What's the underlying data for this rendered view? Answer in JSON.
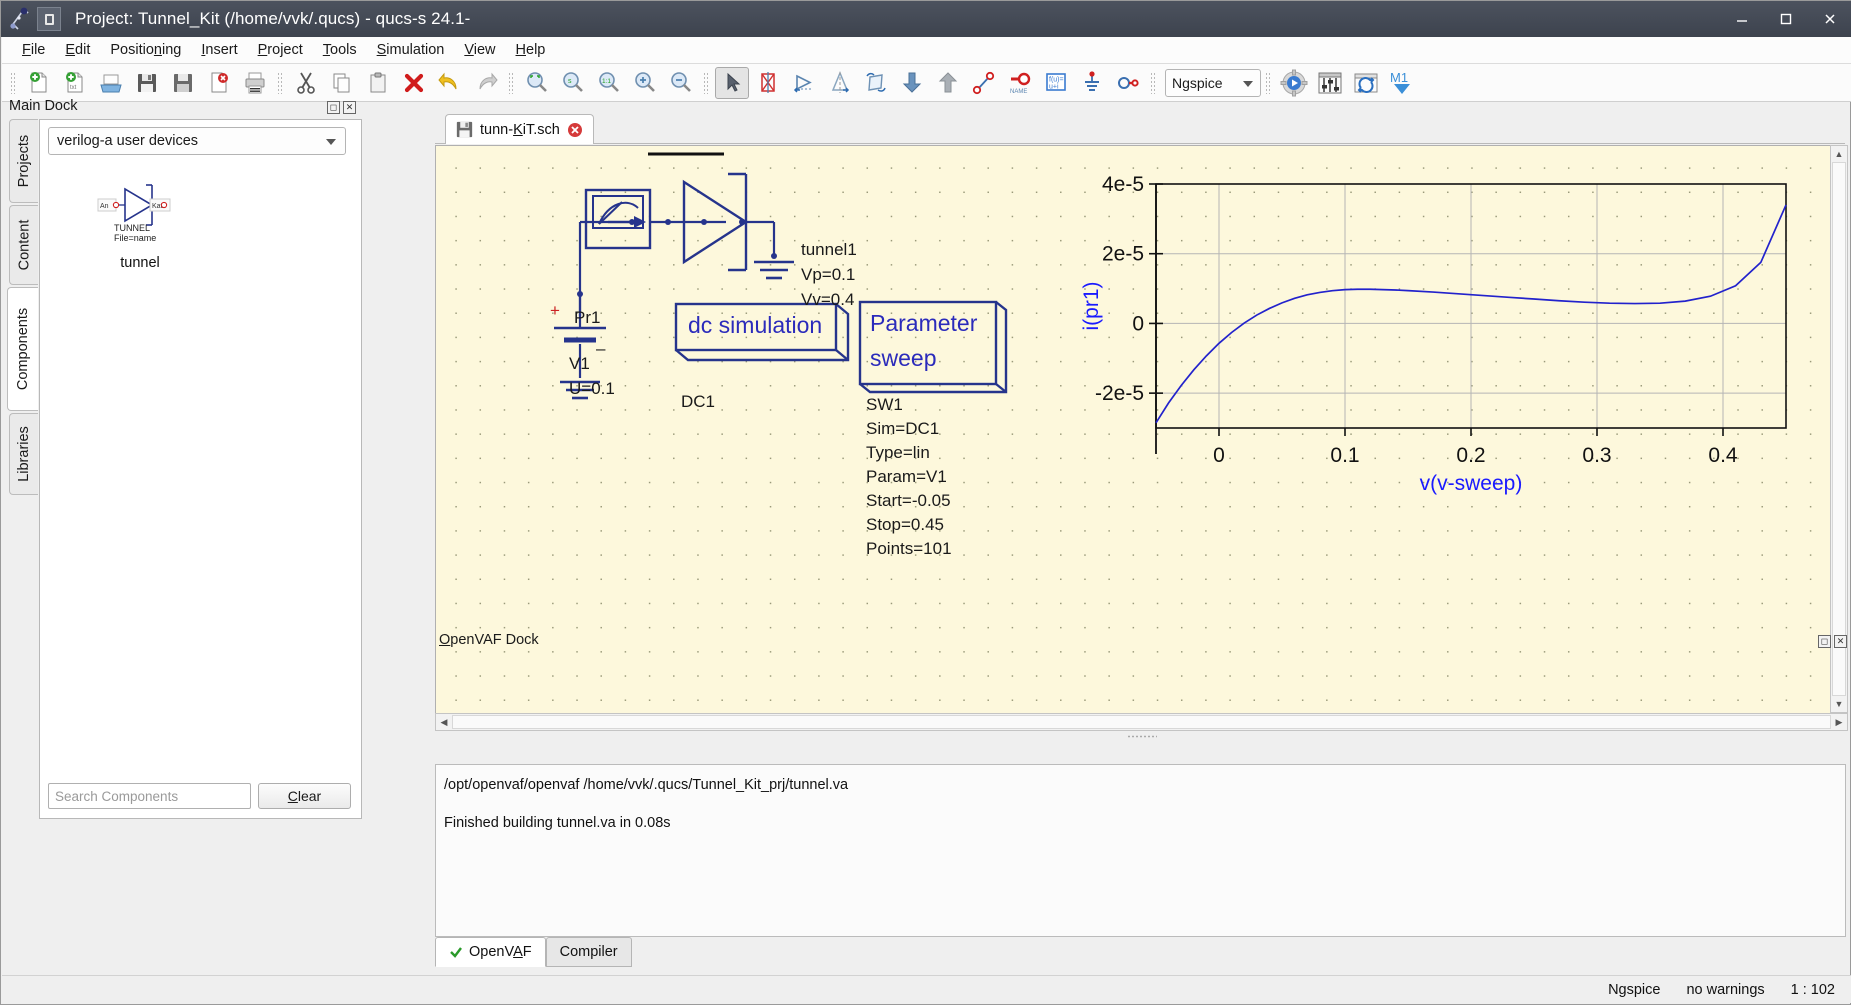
{
  "window": {
    "title": "Project: Tunnel_Kit (/home/vvk/.qucs) - qucs-s 24.1-",
    "minimize": "minimize-button",
    "maximize": "maximize-button",
    "close": "close-button"
  },
  "menu": {
    "items": [
      {
        "label": "File",
        "accel": "F"
      },
      {
        "label": "Edit",
        "accel": "E"
      },
      {
        "label": "Positioning",
        "accel": "n"
      },
      {
        "label": "Insert",
        "accel": "I"
      },
      {
        "label": "Project",
        "accel": "P"
      },
      {
        "label": "Tools",
        "accel": "T"
      },
      {
        "label": "Simulation",
        "accel": "S"
      },
      {
        "label": "View",
        "accel": "V"
      },
      {
        "label": "Help",
        "accel": "H"
      }
    ]
  },
  "toolbar": {
    "simulator_value": "Ngspice",
    "icons": [
      "new-document-icon",
      "new-text-document-icon",
      "open-folder-icon",
      "save-icon",
      "save-as-icon",
      "close-document-icon",
      "print-icon",
      "cut-icon",
      "copy-icon",
      "paste-icon",
      "delete-icon",
      "undo-icon",
      "redo-icon",
      "zoom-area-icon",
      "zoom-fit-icon",
      "zoom-one-to-one-icon",
      "zoom-in-icon",
      "zoom-out-icon",
      "select-arrow-icon",
      "delete-wire-icon",
      "rotate-icon",
      "mirror-x-icon",
      "mirror-y-icon",
      "move-down-icon",
      "move-up-icon",
      "wire-icon",
      "wire-label-icon",
      "equation-icon",
      "ground-icon",
      "port-icon",
      "simulate-icon",
      "settings-sliders-icon",
      "refresh-icon",
      "marker-m1-icon"
    ]
  },
  "main_dock": {
    "title": "Main Dock",
    "tabs": [
      {
        "label": "Projects",
        "selected": false
      },
      {
        "label": "Content",
        "selected": false
      },
      {
        "label": "Components",
        "selected": true
      },
      {
        "label": "Libraries",
        "selected": false
      }
    ],
    "category": "verilog-a user devices",
    "component": {
      "symbol_label_1": "TUNNEL",
      "symbol_label_2": "File=name",
      "pin_left": "An",
      "pin_right": "Kat",
      "caption": "tunnel"
    },
    "search_placeholder": "Search Components",
    "clear_label": "Clear",
    "clear_accel": "C"
  },
  "document": {
    "tab_label": "tunn-KiT.sch",
    "tab_accel": "K",
    "tab_icon": "save-icon",
    "close_icon": "close-tab-icon"
  },
  "schematic": {
    "probe_label": "Pr1",
    "source_name": "V1",
    "source_value": "U=0.1",
    "source_plus": "+",
    "source_minus": "–",
    "device": {
      "name": "tunnel1",
      "params": [
        "Vp=0.1",
        "Vv=0.4"
      ]
    },
    "dc_block": {
      "title": "dc simulation",
      "name": "DC1"
    },
    "sweep_block": {
      "title_line1": "Parameter",
      "title_line2": "sweep",
      "props": [
        "SW1",
        "Sim=DC1",
        "Type=lin",
        "Param=V1",
        "Start=-0.05",
        "Stop=0.45",
        "Points=101"
      ]
    }
  },
  "chart_data": {
    "type": "line",
    "title": "",
    "xlabel": "v(v-sweep)",
    "ylabel": "i(pr1)",
    "xticks": [
      "0",
      "0.1",
      "0.2",
      "0.3",
      "0.4"
    ],
    "xtick_values": [
      0,
      0.1,
      0.2,
      0.3,
      0.4
    ],
    "yticks": [
      "4e-5",
      "2e-5",
      "0",
      "-2e-5"
    ],
    "ytick_values": [
      4e-05,
      2e-05,
      0,
      -2e-05
    ],
    "xlim": [
      -0.05,
      0.45
    ],
    "ylim": [
      -3e-05,
      4e-05
    ],
    "grid": true,
    "legend": false,
    "axis_label_color": "#1a1aff",
    "line_color": "#2222cc",
    "series": [
      {
        "name": "i(pr1)",
        "x": [
          -0.05,
          -0.04,
          -0.03,
          -0.02,
          -0.01,
          0.0,
          0.01,
          0.02,
          0.03,
          0.04,
          0.05,
          0.06,
          0.07,
          0.08,
          0.09,
          0.1,
          0.11,
          0.12,
          0.13,
          0.14,
          0.15,
          0.17,
          0.19,
          0.21,
          0.23,
          0.25,
          0.27,
          0.29,
          0.31,
          0.33,
          0.35,
          0.37,
          0.39,
          0.41,
          0.43,
          0.45
        ],
        "y": [
          -2.85e-05,
          -2.28e-05,
          -1.78e-05,
          -1.33e-05,
          -9.3e-06,
          -5.7e-06,
          -2.6e-06,
          1e-07,
          2.4e-06,
          4.3e-06,
          5.9e-06,
          7.2e-06,
          8.2e-06,
          8.9e-06,
          9.4e-06,
          9.7e-06,
          9.8e-06,
          9.8e-06,
          9.7e-06,
          9.6e-06,
          9.4e-06,
          9e-06,
          8.5e-06,
          8e-06,
          7.5e-06,
          7e-06,
          6.5e-06,
          6.1e-06,
          5.8e-06,
          5.7e-06,
          5.8e-06,
          6.4e-06,
          7.8e-06,
          1.08e-05,
          1.75e-05,
          3.4e-05
        ]
      }
    ]
  },
  "openvaf_dock": {
    "title": "OpenVAF Dock",
    "title_accel": "O",
    "log_lines": [
      "/opt/openvaf/openvaf /home/vvk/.qucs/Tunnel_Kit_prj/tunnel.va",
      "Finished building tunnel.va in 0.08s"
    ],
    "tabs": [
      {
        "label": "OpenVAF",
        "selected": true,
        "icon": "check-icon",
        "accel": "A"
      },
      {
        "label": "Compiler",
        "selected": false,
        "icon": "",
        "accel": ""
      }
    ]
  },
  "statusbar": {
    "simulator": "Ngspice",
    "warnings": "no warnings",
    "position": "1 : 102"
  }
}
